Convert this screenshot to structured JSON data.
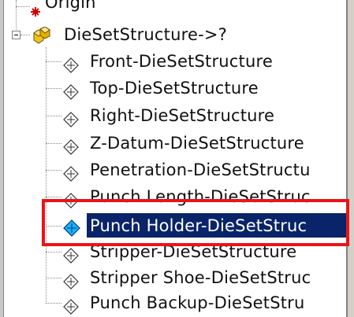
{
  "tree": {
    "top_item": {
      "label": "Origin"
    },
    "parent": {
      "label": "DieSetStructure->?"
    },
    "children": [
      {
        "label": "Front-DieSetStructure"
      },
      {
        "label": "Top-DieSetStructure"
      },
      {
        "label": "Right-DieSetStructure"
      },
      {
        "label": "Z-Datum-DieSetStructure"
      },
      {
        "label": "Penetration-DieSetStructu"
      },
      {
        "label": "Punch Length-DieSetStruc"
      },
      {
        "label": "Punch Holder-DieSetStruc",
        "selected": true
      },
      {
        "label": "Stripper-DieSetStructure"
      },
      {
        "label": "Stripper Shoe-DieSetStruc"
      },
      {
        "label": "Punch Backup-DieSetStru"
      }
    ]
  },
  "colors": {
    "selection": "#0a246a",
    "highlight_box": "#e8141a",
    "plane_icon_selected": "#18b4ff"
  },
  "icons": {
    "top_item": "origin-icon",
    "parent": "dieset-structure-icon",
    "child": "plane-icon"
  }
}
